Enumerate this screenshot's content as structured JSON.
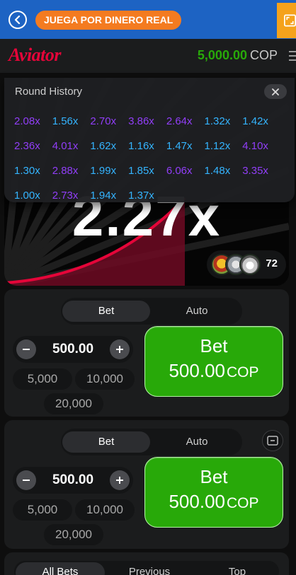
{
  "banner": {
    "promo_label": "JUEGA POR DINERO REAL",
    "back_icon": "chevron-left-icon",
    "expand_icon": "fullscreen-icon"
  },
  "header": {
    "logo": "Aviator",
    "balance_amount": "5,000.00",
    "balance_currency": "COP",
    "menu_icon": "hamburger-icon"
  },
  "colors": {
    "brand_red": "#e50539",
    "bet_green": "#28a909",
    "history_blue": "#34b4ff",
    "history_purple": "#913ef8",
    "promo_orange": "#f47b20",
    "topbar_blue": "#1d63c3"
  },
  "game": {
    "multiplier": "2.27x",
    "players_online": "72"
  },
  "round_history": {
    "title": "Round History",
    "rows": [
      [
        {
          "v": "2.08x",
          "c": "purple"
        },
        {
          "v": "1.56x",
          "c": "blue"
        },
        {
          "v": "2.70x",
          "c": "purple"
        },
        {
          "v": "3.86x",
          "c": "purple"
        },
        {
          "v": "2.64x",
          "c": "purple"
        },
        {
          "v": "1.32x",
          "c": "blue"
        },
        {
          "v": "1.42x",
          "c": "blue"
        }
      ],
      [
        {
          "v": "2.36x",
          "c": "purple"
        },
        {
          "v": "4.01x",
          "c": "purple"
        },
        {
          "v": "1.62x",
          "c": "blue"
        },
        {
          "v": "1.16x",
          "c": "blue"
        },
        {
          "v": "1.47x",
          "c": "blue"
        },
        {
          "v": "1.12x",
          "c": "blue"
        },
        {
          "v": "4.10x",
          "c": "purple"
        }
      ],
      [
        {
          "v": "1.30x",
          "c": "blue"
        },
        {
          "v": "2.88x",
          "c": "purple"
        },
        {
          "v": "1.99x",
          "c": "blue"
        },
        {
          "v": "1.85x",
          "c": "blue"
        },
        {
          "v": "6.06x",
          "c": "purple"
        },
        {
          "v": "1.48x",
          "c": "blue"
        },
        {
          "v": "3.35x",
          "c": "purple"
        }
      ],
      [
        {
          "v": "1.00x",
          "c": "blue"
        },
        {
          "v": "2.73x",
          "c": "purple"
        },
        {
          "v": "1.94x",
          "c": "blue"
        },
        {
          "v": "1.37x",
          "c": "blue"
        }
      ]
    ]
  },
  "bet_panels": [
    {
      "tab_bet": "Bet",
      "tab_auto": "Auto",
      "active_tab": "Bet",
      "stake": "500.00",
      "chips": [
        "5,000",
        "10,000",
        "20,000"
      ],
      "button_label": "Bet",
      "button_amount": "500.00",
      "button_currency": "COP"
    },
    {
      "tab_bet": "Bet",
      "tab_auto": "Auto",
      "active_tab": "Bet",
      "stake": "500.00",
      "chips": [
        "5,000",
        "10,000",
        "20,000"
      ],
      "button_label": "Bet",
      "button_amount": "500.00",
      "button_currency": "COP"
    }
  ],
  "bottom_tabs": [
    "All Bets",
    "Previous",
    "Top"
  ]
}
